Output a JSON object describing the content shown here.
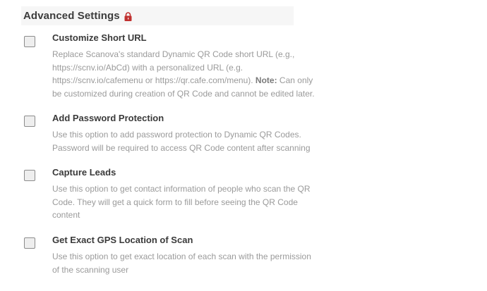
{
  "header": {
    "title": "Advanced Settings",
    "icon": "lock-icon",
    "icon_color": "#c0302f"
  },
  "options": [
    {
      "title": "Customize Short URL",
      "description_lines": [
        "Replace Scanova's standard Dynamic QR Code short URL (e.g.,",
        "https://scnv.io/AbCd) with a personalized URL (e.g.",
        "https://scnv.io/cafemenu or https://qr.cafe.com/menu)."
      ],
      "note_label": "Note:",
      "note_text_lines": [
        " Can only",
        "be customized during creation of QR Code and cannot be edited later."
      ],
      "checked": false
    },
    {
      "title": "Add Password Protection",
      "description_lines": [
        "Use this option to add password protection to Dynamic QR Codes.",
        "Password will be required to access QR Code content after scanning"
      ],
      "checked": false
    },
    {
      "title": "Capture Leads",
      "description_lines": [
        "Use this option to get contact information of people who scan the QR",
        "Code. They will get a quick form to fill before seeing the QR Code",
        "content"
      ],
      "checked": false
    },
    {
      "title": "Get Exact GPS Location of Scan",
      "description_lines": [
        "Use this option to get exact location of each scan with the permission",
        "of the scanning user"
      ],
      "checked": false
    }
  ]
}
